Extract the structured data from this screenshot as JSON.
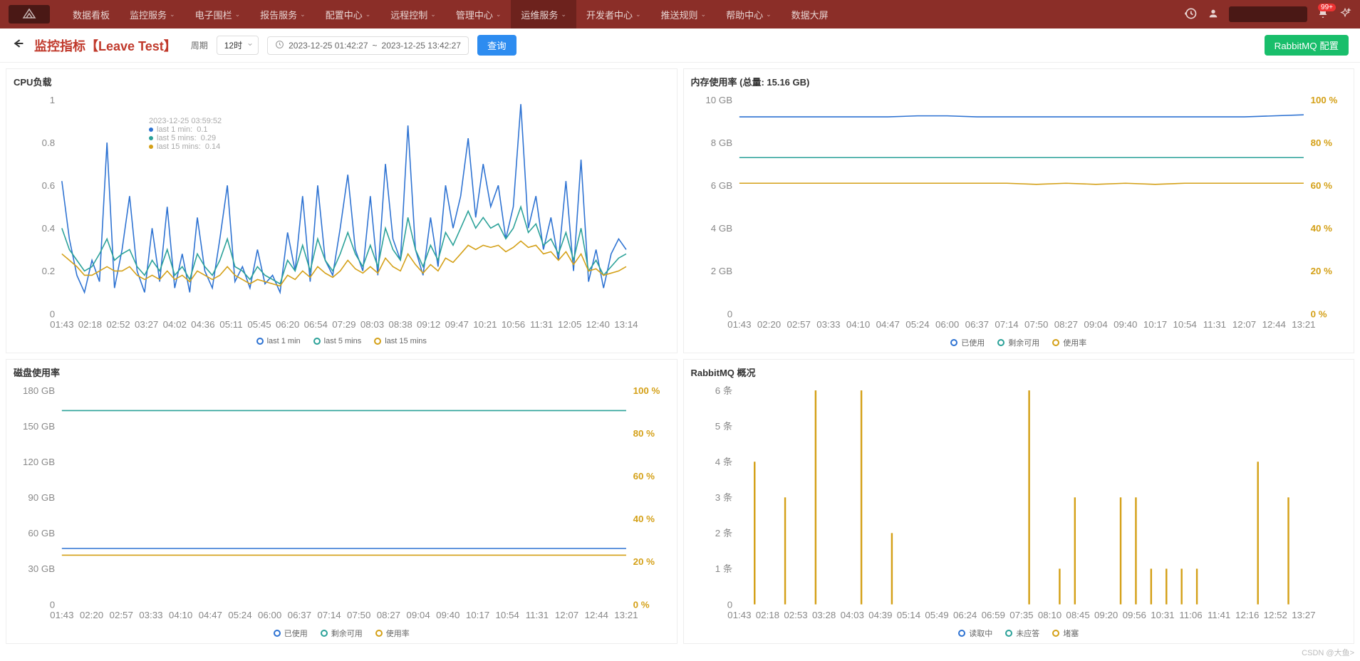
{
  "nav": {
    "items": [
      "数据看板",
      "监控服务",
      "电子围栏",
      "报告服务",
      "配置中心",
      "远程控制",
      "管理中心",
      "运维服务",
      "开发者中心",
      "推送规则",
      "帮助中心",
      "数据大屏"
    ],
    "active_index": 7,
    "no_dropdown": [
      0,
      11
    ],
    "badge": "99+"
  },
  "toolbar": {
    "title": "监控指标【Leave Test】",
    "period_label": "周期",
    "period_value": "12时",
    "start_time": "2023-12-25 01:42:27",
    "end_time": "2023-12-25 13:42:27",
    "sep": "~",
    "query_btn": "查询",
    "rabbit_btn": "RabbitMQ 配置"
  },
  "colors": {
    "blue": "#2d72d2",
    "teal": "#2aa198",
    "gold": "#d4a017"
  },
  "tooltip_cpu": {
    "time": "2023-12-25 03:59:52",
    "rows": [
      {
        "label": "last 1 min:",
        "value": "0.1",
        "color": "#2d72d2"
      },
      {
        "label": "last 5 mins:",
        "value": "0.29",
        "color": "#2aa198"
      },
      {
        "label": "last 15 mins:",
        "value": "0.14",
        "color": "#d4a017"
      }
    ]
  },
  "watermark": "CSDN @大鱼>",
  "chart_data": [
    {
      "id": "cpu",
      "type": "line",
      "title": "CPU负载",
      "ylim": [
        0,
        1
      ],
      "yticks": [
        0,
        0.2,
        0.4,
        0.6,
        0.8,
        1
      ],
      "x_labels": [
        "01:43",
        "02:18",
        "02:52",
        "03:27",
        "04:02",
        "04:36",
        "05:11",
        "05:45",
        "06:20",
        "06:54",
        "07:29",
        "08:03",
        "08:38",
        "09:12",
        "09:47",
        "10:21",
        "10:56",
        "11:31",
        "12:05",
        "12:40",
        "13:14"
      ],
      "legend": [
        "last 1 min",
        "last 5 mins",
        "last 15 mins"
      ],
      "series": [
        {
          "name": "last 1 min",
          "color": "#2d72d2",
          "values": [
            0.62,
            0.35,
            0.18,
            0.1,
            0.25,
            0.15,
            0.8,
            0.12,
            0.3,
            0.55,
            0.2,
            0.1,
            0.4,
            0.15,
            0.5,
            0.12,
            0.28,
            0.1,
            0.45,
            0.2,
            0.12,
            0.35,
            0.6,
            0.15,
            0.22,
            0.12,
            0.3,
            0.14,
            0.18,
            0.1,
            0.38,
            0.2,
            0.55,
            0.15,
            0.6,
            0.25,
            0.18,
            0.4,
            0.65,
            0.3,
            0.2,
            0.55,
            0.18,
            0.7,
            0.35,
            0.25,
            0.88,
            0.3,
            0.18,
            0.45,
            0.22,
            0.6,
            0.4,
            0.55,
            0.82,
            0.45,
            0.7,
            0.5,
            0.6,
            0.35,
            0.5,
            0.98,
            0.4,
            0.55,
            0.3,
            0.45,
            0.25,
            0.62,
            0.2,
            0.72,
            0.15,
            0.3,
            0.12,
            0.28,
            0.35,
            0.3
          ]
        },
        {
          "name": "last 5 mins",
          "color": "#2aa198",
          "values": [
            0.4,
            0.3,
            0.25,
            0.2,
            0.22,
            0.28,
            0.35,
            0.25,
            0.28,
            0.3,
            0.22,
            0.18,
            0.25,
            0.2,
            0.3,
            0.18,
            0.22,
            0.16,
            0.28,
            0.22,
            0.18,
            0.25,
            0.35,
            0.22,
            0.2,
            0.16,
            0.22,
            0.18,
            0.16,
            0.14,
            0.25,
            0.2,
            0.32,
            0.2,
            0.35,
            0.25,
            0.2,
            0.28,
            0.38,
            0.28,
            0.22,
            0.32,
            0.22,
            0.4,
            0.3,
            0.25,
            0.45,
            0.3,
            0.22,
            0.32,
            0.25,
            0.38,
            0.32,
            0.4,
            0.48,
            0.4,
            0.45,
            0.4,
            0.42,
            0.35,
            0.4,
            0.5,
            0.38,
            0.42,
            0.32,
            0.35,
            0.28,
            0.38,
            0.25,
            0.4,
            0.2,
            0.25,
            0.18,
            0.22,
            0.26,
            0.28
          ]
        },
        {
          "name": "last 15 mins",
          "color": "#d4a017",
          "values": [
            0.28,
            0.25,
            0.22,
            0.18,
            0.18,
            0.2,
            0.22,
            0.2,
            0.2,
            0.22,
            0.18,
            0.16,
            0.18,
            0.16,
            0.2,
            0.16,
            0.18,
            0.15,
            0.2,
            0.18,
            0.16,
            0.18,
            0.22,
            0.18,
            0.16,
            0.14,
            0.16,
            0.15,
            0.14,
            0.13,
            0.18,
            0.16,
            0.2,
            0.17,
            0.22,
            0.19,
            0.17,
            0.2,
            0.25,
            0.21,
            0.19,
            0.22,
            0.19,
            0.26,
            0.22,
            0.2,
            0.28,
            0.23,
            0.19,
            0.23,
            0.2,
            0.26,
            0.24,
            0.28,
            0.32,
            0.3,
            0.32,
            0.31,
            0.32,
            0.29,
            0.31,
            0.34,
            0.31,
            0.32,
            0.28,
            0.29,
            0.25,
            0.29,
            0.23,
            0.28,
            0.2,
            0.21,
            0.18,
            0.19,
            0.2,
            0.22
          ]
        }
      ]
    },
    {
      "id": "mem",
      "type": "line",
      "title": "内存使用率",
      "subtitle": "(总量: 15.16 GB)",
      "ylim": [
        0,
        10
      ],
      "yticks": [
        0,
        "2 GB",
        "4 GB",
        "6 GB",
        "8 GB",
        "10 GB"
      ],
      "y2lim": [
        0,
        100
      ],
      "y2ticks": [
        "0 %",
        "20 %",
        "40 %",
        "60 %",
        "80 %",
        "100 %"
      ],
      "x_labels": [
        "01:43",
        "02:20",
        "02:57",
        "03:33",
        "04:10",
        "04:47",
        "05:24",
        "06:00",
        "06:37",
        "07:14",
        "07:50",
        "08:27",
        "09:04",
        "09:40",
        "10:17",
        "10:54",
        "11:31",
        "12:07",
        "12:44",
        "13:21"
      ],
      "legend": [
        "已使用",
        "剩余可用",
        "使用率"
      ],
      "series": [
        {
          "name": "已使用",
          "color": "#2d72d2",
          "values": [
            9.2,
            9.2,
            9.2,
            9.2,
            9.2,
            9.2,
            9.25,
            9.25,
            9.2,
            9.2,
            9.2,
            9.2,
            9.2,
            9.2,
            9.2,
            9.2,
            9.2,
            9.2,
            9.25,
            9.3
          ]
        },
        {
          "name": "剩余可用",
          "color": "#2aa198",
          "values": [
            7.3,
            7.3,
            7.3,
            7.3,
            7.3,
            7.3,
            7.3,
            7.3,
            7.3,
            7.3,
            7.3,
            7.3,
            7.3,
            7.3,
            7.3,
            7.3,
            7.3,
            7.3,
            7.3,
            7.3
          ]
        },
        {
          "name": "使用率",
          "color": "#d4a017",
          "axis": "y2",
          "values": [
            61,
            61,
            61,
            61,
            61,
            61,
            61,
            61,
            61,
            61,
            60.5,
            61,
            60.5,
            61,
            60.5,
            61,
            61,
            61,
            61,
            61
          ]
        }
      ]
    },
    {
      "id": "disk",
      "type": "line",
      "title": "磁盘使用率",
      "ylim": [
        0,
        180
      ],
      "yticks": [
        0,
        "30 GB",
        "60 GB",
        "90 GB",
        "120 GB",
        "150 GB",
        "180 GB"
      ],
      "y2lim": [
        0,
        100
      ],
      "y2ticks": [
        "0 %",
        "20 %",
        "40 %",
        "60 %",
        "80 %",
        "100 %"
      ],
      "x_labels": [
        "01:43",
        "02:20",
        "02:57",
        "03:33",
        "04:10",
        "04:47",
        "05:24",
        "06:00",
        "06:37",
        "07:14",
        "07:50",
        "08:27",
        "09:04",
        "09:40",
        "10:17",
        "10:54",
        "11:31",
        "12:07",
        "12:44",
        "13:21"
      ],
      "legend": [
        "已使用",
        "剩余可用",
        "使用率"
      ],
      "series": [
        {
          "name": "已使用",
          "color": "#2d72d2",
          "values": [
            47,
            47,
            47,
            47,
            47,
            47,
            47,
            47,
            47,
            47,
            47,
            47,
            47,
            47,
            47,
            47,
            47,
            47,
            47,
            47
          ]
        },
        {
          "name": "剩余可用",
          "color": "#2aa198",
          "values": [
            163,
            163,
            163,
            163,
            163,
            163,
            163,
            163,
            163,
            163,
            163,
            163,
            163,
            163,
            163,
            163,
            163,
            163,
            163,
            163
          ]
        },
        {
          "name": "使用率",
          "color": "#d4a017",
          "axis": "y2",
          "values": [
            23,
            23,
            23,
            23,
            23,
            23,
            23,
            23,
            23,
            23,
            23,
            23,
            23,
            23,
            23,
            23,
            23,
            23,
            23,
            23
          ]
        }
      ]
    },
    {
      "id": "rabbit",
      "type": "bar",
      "title": "RabbitMQ 概况",
      "ylim": [
        0,
        6
      ],
      "yticks": [
        "0",
        "1 条",
        "2 条",
        "3 条",
        "4 条",
        "5 条",
        "6 条"
      ],
      "x_labels": [
        "01:43",
        "02:18",
        "02:53",
        "03:28",
        "04:03",
        "04:39",
        "05:14",
        "05:49",
        "06:24",
        "06:59",
        "07:35",
        "08:10",
        "08:45",
        "09:20",
        "09:56",
        "10:31",
        "11:06",
        "11:41",
        "12:16",
        "12:52",
        "13:27"
      ],
      "legend": [
        "读取中",
        "未应答",
        "堵塞"
      ],
      "series": [
        {
          "name": "堵塞",
          "color": "#d4a017",
          "values": [
            0,
            4,
            0,
            3,
            0,
            6,
            0,
            0,
            6,
            0,
            2,
            0,
            0,
            0,
            0,
            0,
            0,
            0,
            0,
            6,
            0,
            1,
            3,
            0,
            0,
            3,
            3,
            1,
            1,
            1,
            1,
            0,
            0,
            0,
            4,
            0,
            3,
            0
          ]
        }
      ]
    }
  ]
}
